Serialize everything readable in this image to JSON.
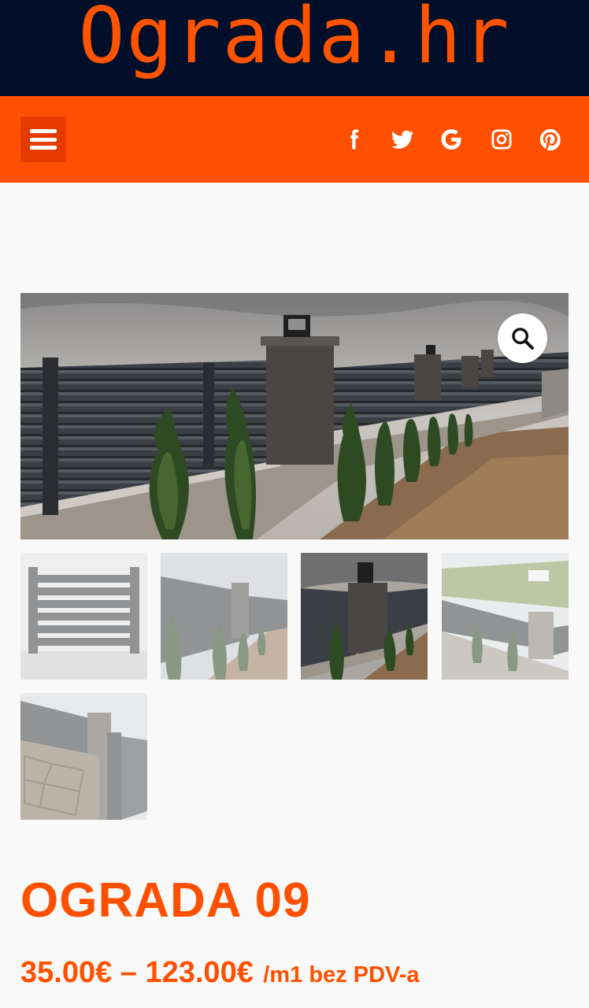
{
  "header": {
    "logo_text": "Ograda.hr"
  },
  "nav": {
    "menu_icon": "hamburger-menu-icon",
    "social_icons": [
      "facebook-icon",
      "twitter-icon",
      "google-icon",
      "instagram-icon",
      "pinterest-icon"
    ]
  },
  "gallery": {
    "zoom_icon": "magnifier-icon",
    "thumbnail_count": 5,
    "active_thumbnail": 3
  },
  "product": {
    "title": "OGRADA 09",
    "price_range": "35.00€ – 123.00€",
    "price_unit": "/m1 bez PDV-a"
  },
  "colors": {
    "brand_orange": "#fe5000",
    "header_navy": "#020f2a"
  }
}
